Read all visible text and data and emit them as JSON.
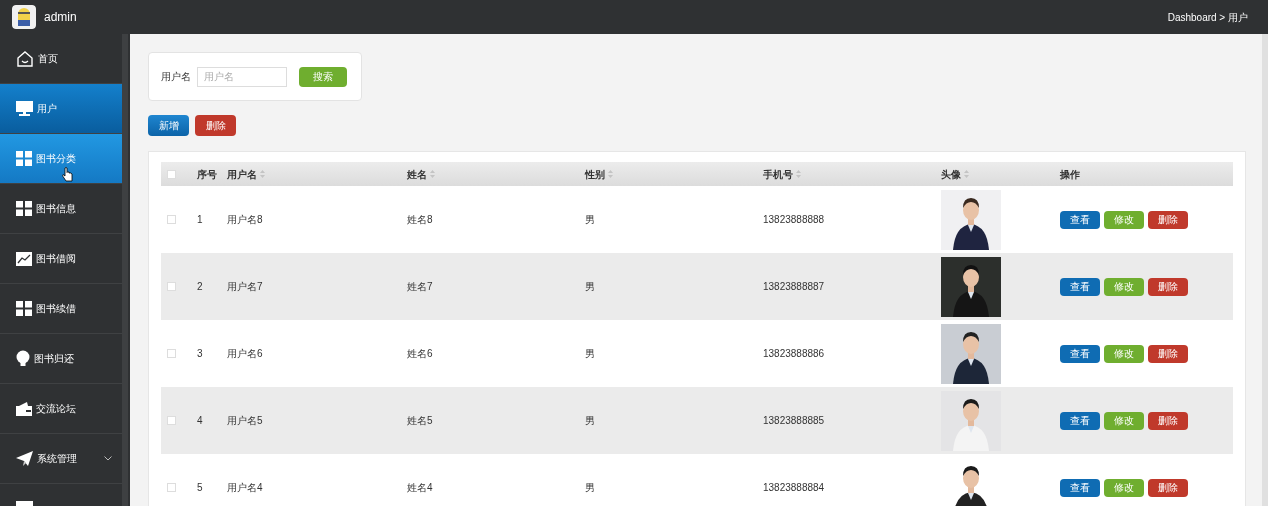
{
  "header": {
    "user": "admin",
    "breadcrumb": "Dashboard > 用户"
  },
  "sidebar": {
    "items": [
      {
        "label": "首页",
        "selected": false,
        "hovered": false
      },
      {
        "label": "用户",
        "selected": true,
        "hovered": false
      },
      {
        "label": "图书分类",
        "selected": false,
        "hovered": true
      },
      {
        "label": "图书信息",
        "selected": false,
        "hovered": false
      },
      {
        "label": "图书借阅",
        "selected": false,
        "hovered": false
      },
      {
        "label": "图书续借",
        "selected": false,
        "hovered": false
      },
      {
        "label": "图书归还",
        "selected": false,
        "hovered": false
      },
      {
        "label": "交流论坛",
        "selected": false,
        "hovered": false
      },
      {
        "label": "系统管理",
        "selected": false,
        "hovered": false,
        "expandable": true
      },
      {
        "selected": false,
        "hovered": false
      }
    ]
  },
  "search": {
    "label": "用户名",
    "placeholder": "用户名",
    "button": "搜索"
  },
  "actions": [
    "新增",
    "删除"
  ],
  "table": {
    "select_all": false,
    "columns": [
      {
        "label": "序号",
        "sortable": false
      },
      {
        "label": "用户名",
        "sortable": true
      },
      {
        "label": "姓名",
        "sortable": true
      },
      {
        "label": "性别",
        "sortable": true
      },
      {
        "label": "手机号",
        "sortable": true
      },
      {
        "label": "头像",
        "sortable": true
      },
      {
        "label": "操作",
        "sortable": false
      }
    ],
    "rows": [
      {
        "checked": false,
        "index": "1",
        "username": "用户名8",
        "name": "姓名8",
        "gender": "男",
        "phone": "13823888888",
        "buttons": [
          "查看",
          "修改",
          "删除"
        ]
      },
      {
        "checked": false,
        "index": "2",
        "username": "用户名7",
        "name": "姓名7",
        "gender": "男",
        "phone": "13823888887",
        "buttons": [
          "查看",
          "修改",
          "删除"
        ]
      },
      {
        "checked": false,
        "index": "3",
        "username": "用户名6",
        "name": "姓名6",
        "gender": "男",
        "phone": "13823888886",
        "buttons": [
          "查看",
          "修改",
          "删除"
        ]
      },
      {
        "checked": false,
        "index": "4",
        "username": "用户名5",
        "name": "姓名5",
        "gender": "男",
        "phone": "13823888885",
        "buttons": [
          "查看",
          "修改",
          "删除"
        ]
      },
      {
        "checked": false,
        "index": "5",
        "username": "用户名4",
        "name": "姓名4",
        "gender": "男",
        "phone": "13823888884",
        "buttons": [
          "查看",
          "修改",
          "删除"
        ]
      }
    ]
  }
}
